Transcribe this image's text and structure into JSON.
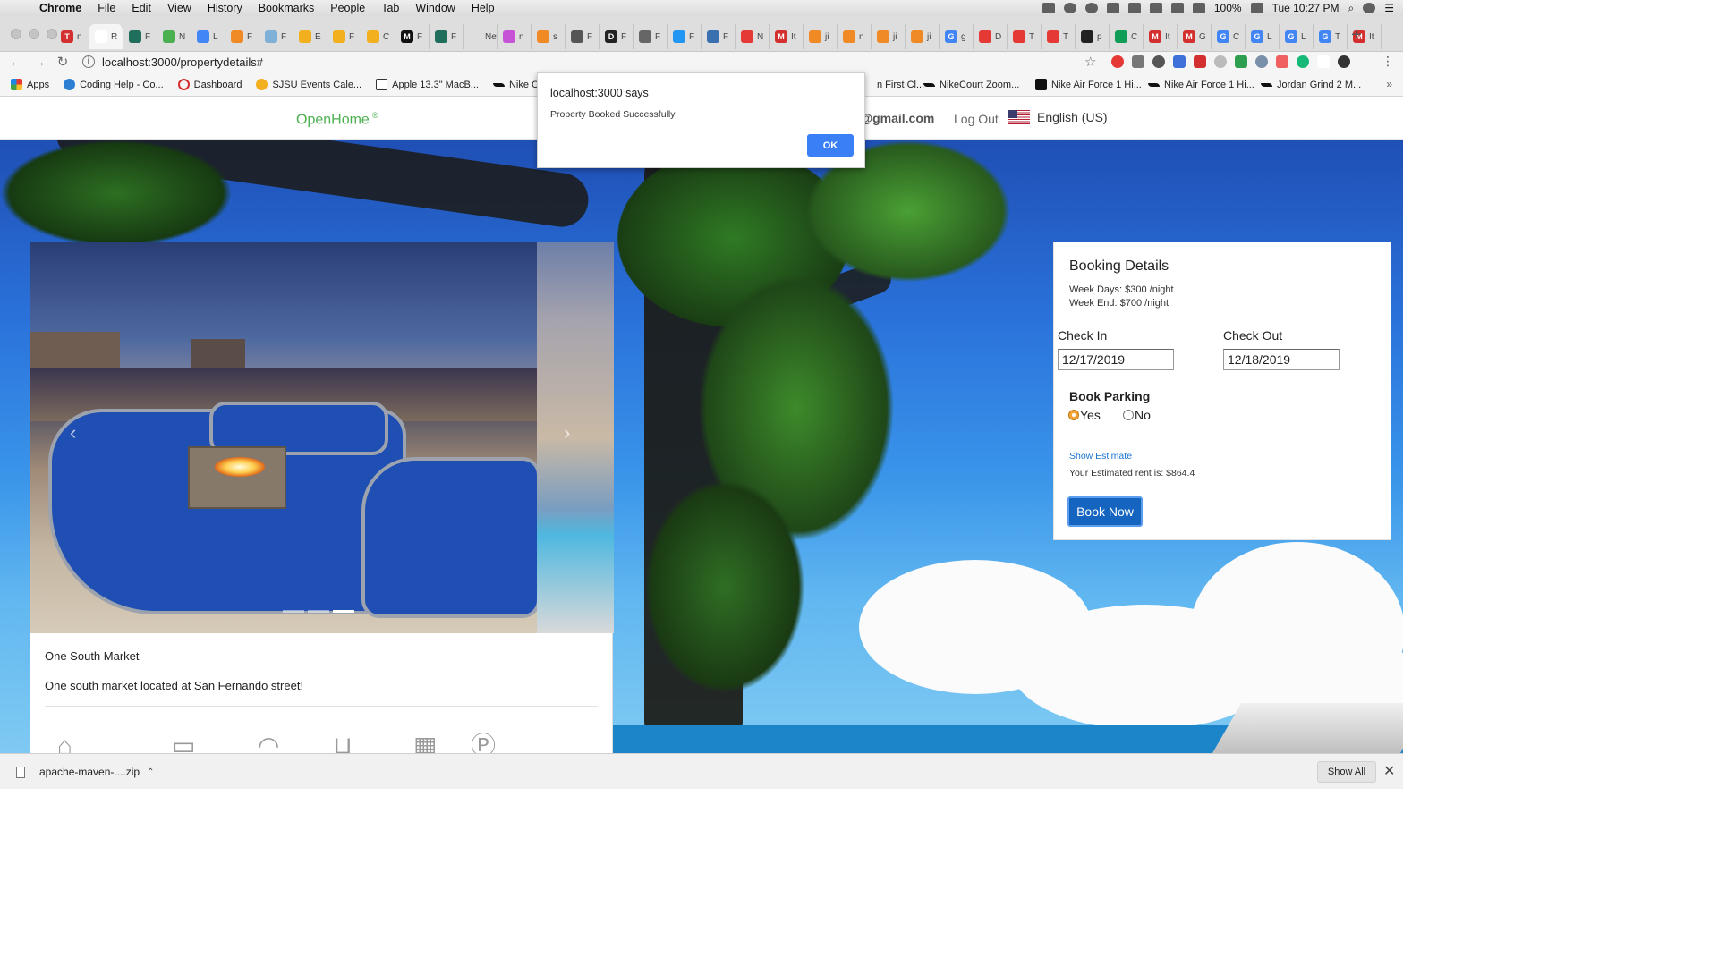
{
  "os_menubar": {
    "app": "Chrome",
    "items": [
      "File",
      "Edit",
      "View",
      "History",
      "Bookmarks",
      "People",
      "Tab",
      "Window",
      "Help"
    ],
    "battery": "100%",
    "clock": "Tue 10:27 PM"
  },
  "browser": {
    "tabs": [
      {
        "label": "n",
        "fav": "#d32f2f",
        "letter": "T"
      },
      {
        "label": "R",
        "fav": "#fff",
        "letter": "",
        "active": true
      },
      {
        "label": "F",
        "fav": "#1f6f5c",
        "letter": ""
      },
      {
        "label": "N",
        "fav": "#4caf50",
        "letter": ""
      },
      {
        "label": "L",
        "fav": "#4285f4",
        "letter": ""
      },
      {
        "label": "F",
        "fav": "#f08a24",
        "letter": ""
      },
      {
        "label": "F",
        "fav": "#7fb0d8",
        "letter": ""
      },
      {
        "label": "E",
        "fav": "#f2b01e",
        "letter": ""
      },
      {
        "label": "F",
        "fav": "#f2b01e",
        "letter": ""
      },
      {
        "label": "C",
        "fav": "#f2b01e",
        "letter": ""
      },
      {
        "label": "F",
        "fav": "#111",
        "letter": "M"
      },
      {
        "label": "F",
        "fav": "#1f6f5c",
        "letter": ""
      },
      {
        "label": "New",
        "fav": "#dedede",
        "letter": ""
      },
      {
        "label": "n",
        "fav": "#c653d6",
        "letter": ""
      },
      {
        "label": "s",
        "fav": "#f08a24",
        "letter": ""
      },
      {
        "label": "F",
        "fav": "#555",
        "letter": ""
      },
      {
        "label": "F",
        "fav": "#222",
        "letter": "D"
      },
      {
        "label": "F",
        "fav": "#666",
        "letter": ""
      },
      {
        "label": "F",
        "fav": "#2196f3",
        "letter": ""
      },
      {
        "label": "F",
        "fav": "#3a6fb0",
        "letter": ""
      },
      {
        "label": "N",
        "fav": "#e53935",
        "letter": ""
      },
      {
        "label": "It",
        "fav": "#d32f2f",
        "letter": "M"
      },
      {
        "label": "ji",
        "fav": "#f08a24",
        "letter": ""
      },
      {
        "label": "n",
        "fav": "#f08a24",
        "letter": ""
      },
      {
        "label": "ji",
        "fav": "#f08a24",
        "letter": ""
      },
      {
        "label": "ji",
        "fav": "#f08a24",
        "letter": ""
      },
      {
        "label": "g",
        "fav": "#4285f4",
        "letter": "G"
      },
      {
        "label": "D",
        "fav": "#e53935",
        "letter": ""
      },
      {
        "label": "T",
        "fav": "#e53935",
        "letter": ""
      },
      {
        "label": "T",
        "fav": "#e53935",
        "letter": ""
      },
      {
        "label": "p",
        "fav": "#222",
        "letter": ""
      },
      {
        "label": "C",
        "fav": "#0f9d58",
        "letter": ""
      },
      {
        "label": "It",
        "fav": "#d32f2f",
        "letter": "M"
      },
      {
        "label": "G",
        "fav": "#d32f2f",
        "letter": "M"
      },
      {
        "label": "C",
        "fav": "#4285f4",
        "letter": "G"
      },
      {
        "label": "L",
        "fav": "#4285f4",
        "letter": "G"
      },
      {
        "label": "L",
        "fav": "#4285f4",
        "letter": "G"
      },
      {
        "label": "T",
        "fav": "#4285f4",
        "letter": "G"
      },
      {
        "label": "It",
        "fav": "#d32f2f",
        "letter": "M"
      }
    ],
    "url": "localhost:3000/propertydetails#",
    "bookmarks": [
      {
        "label": "Apps",
        "color": "#e53935"
      },
      {
        "label": "Coding Help - Co...",
        "color": "#2a7fd4"
      },
      {
        "label": "Dashboard",
        "color": "#d32f2f"
      },
      {
        "label": "SJSU Events Cale...",
        "color": "#f2b01e"
      },
      {
        "label": "Apple 13.3\" MacB...",
        "color": "#333"
      },
      {
        "label": "Nike Cortez",
        "color": "#111"
      },
      {
        "label": "n First Cl...",
        "color": "#111"
      },
      {
        "label": "NikeCourt Zoom...",
        "color": "#111"
      },
      {
        "label": "Nike Air Force 1 Hi...",
        "color": "#111"
      },
      {
        "label": "Nike Air Force 1 Hi...",
        "color": "#111"
      },
      {
        "label": "Jordan Grind 2 M...",
        "color": "#111"
      }
    ]
  },
  "navbar": {
    "brand": "OpenHome",
    "brand_mark": "®",
    "user_email_fragment": "r@gmail.com",
    "logout": "Log Out",
    "language": "English (US)"
  },
  "property": {
    "name": "One South Market",
    "description": "One south market located at San Fernando street!",
    "carousel": {
      "slides": 3,
      "active_index": 2
    },
    "amenity_icons": [
      "home-icon",
      "bed-icon",
      "wifi-icon",
      "bathtub-icon",
      "building-icon",
      "parking-icon"
    ]
  },
  "booking": {
    "title": "Booking Details",
    "weekday_rate": "Week Days: $300 /night",
    "weekend_rate": "Week End: $700 /night",
    "checkin_label": "Check In",
    "checkin_value": "12/17/2019",
    "checkout_label": "Check Out",
    "checkout_value": "12/18/2019",
    "parking_label": "Book Parking",
    "parking_yes": "Yes",
    "parking_no": "No",
    "parking_selected": "Yes",
    "show_estimate": "Show Estimate",
    "estimate_text": "Your Estimated rent is: $864.4",
    "book_now": "Book Now"
  },
  "dialog": {
    "title": "localhost:3000 says",
    "message": "Property Booked Successfully",
    "ok": "OK"
  },
  "downloads": {
    "file": "apache-maven-....zip",
    "show_all": "Show All"
  }
}
